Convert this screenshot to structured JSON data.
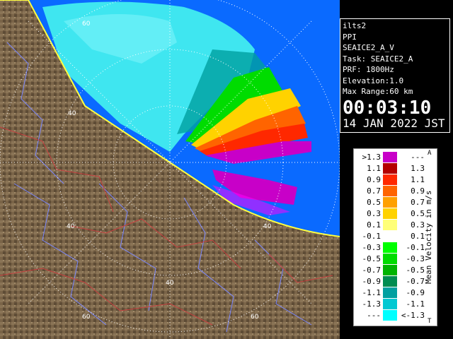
{
  "info": {
    "site": "ilts2",
    "product": "PPI",
    "volume": "SEAICE2_A_V",
    "task": "Task: SEAICE2_A",
    "prf": "PRF: 1800Hz",
    "elevation": "Elevation:1.0",
    "max_range": "Max Range:60 km",
    "time": "00:03:10",
    "date": "14 JAN 2022 JST"
  },
  "range_labels": [
    "40",
    "60"
  ],
  "legend": {
    "title": "Mean Velocity in m/s",
    "top_mark": "A",
    "bottom_mark": "T",
    "rows": [
      {
        "left": ">1.3",
        "right": "---",
        "color": "#c800c8"
      },
      {
        "left": "1.1",
        "right": "1.3",
        "color": "#b40000"
      },
      {
        "left": "0.9",
        "right": "1.1",
        "color": "#ff2800"
      },
      {
        "left": "0.7",
        "right": "0.9",
        "color": "#ff6400"
      },
      {
        "left": "0.5",
        "right": "0.7",
        "color": "#ffa000"
      },
      {
        "left": "0.3",
        "right": "0.5",
        "color": "#ffd200"
      },
      {
        "left": "0.1",
        "right": "0.3",
        "color": "#ffff78"
      },
      {
        "left": "-0.1",
        "right": "0.1",
        "color": "#ffffff"
      },
      {
        "left": "-0.3",
        "right": "-0.1",
        "color": "#00ff00"
      },
      {
        "left": "-0.5",
        "right": "-0.3",
        "color": "#00dc00"
      },
      {
        "left": "-0.7",
        "right": "-0.5",
        "color": "#00b400"
      },
      {
        "left": "-0.9",
        "right": "-0.7",
        "color": "#008c50"
      },
      {
        "left": "-1.1",
        "right": "-0.9",
        "color": "#00a0a0"
      },
      {
        "left": "-1.3",
        "right": "-1.1",
        "color": "#00c8d2"
      },
      {
        "left": "---",
        "right": "<-1.3",
        "color": "#00ffff"
      }
    ]
  },
  "colors": {
    "land": "#7a6448",
    "sea": "#0a6aff",
    "cyan_echo": "#3fe6f0",
    "background": "#000000"
  }
}
